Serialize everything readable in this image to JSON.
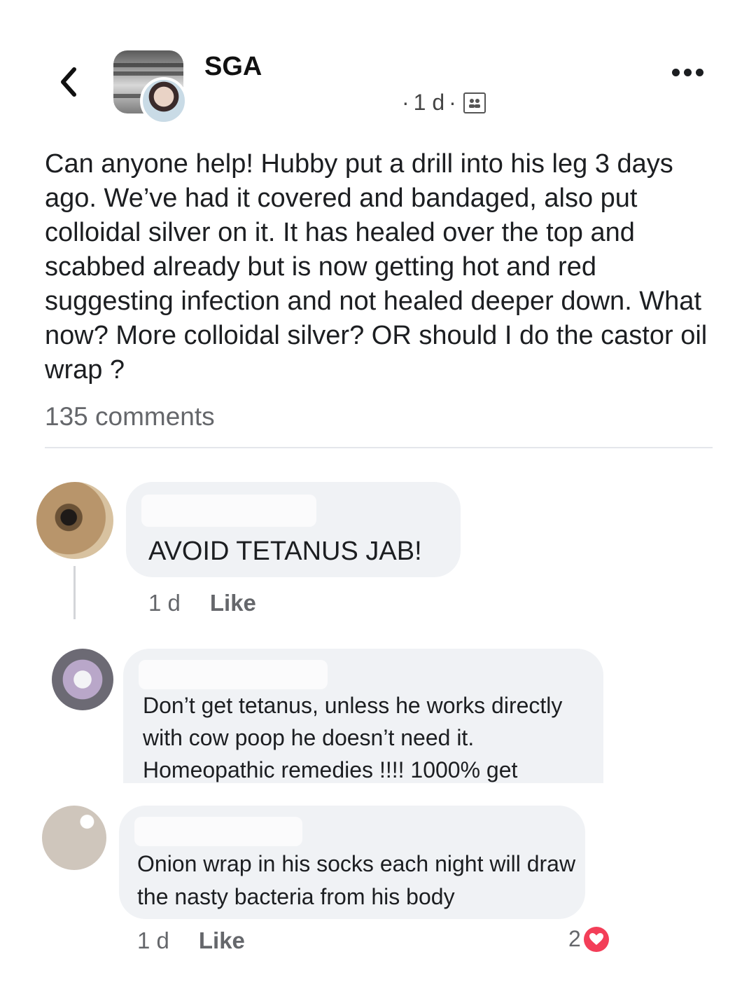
{
  "post": {
    "author": "SGA",
    "timestamp_prefix": "·",
    "timestamp": "1 d",
    "timestamp_suffix": "·",
    "text": "Can anyone help! Hubby put a drill into his leg 3 days ago. We’ve had it covered and bandaged, also put colloidal silver on it. It has healed over the top and scabbed already but is now getting hot and red suggesting infection and not healed deeper down. What now? More colloidal silver? OR should I do the castor oil wrap ?",
    "comments_count_label": "135 comments",
    "privacy_icon": "group-members-icon"
  },
  "comments": [
    {
      "text": "AVOID TETANUS JAB!",
      "time": "1 d",
      "like_label": "Like"
    },
    {
      "text": "Don’t get tetanus, unless he works directly with cow poop he doesn’t need it. Homeopathic remedies !!!! 1000% get"
    },
    {
      "text": "Onion wrap in his socks each night will draw the nasty bacteria from his body",
      "time": "1 d",
      "like_label": "Like",
      "reaction_count": "2",
      "reaction_icon": "heart-icon"
    }
  ],
  "colors": {
    "bubble": "#f0f2f5",
    "heart": "#f33e58",
    "secondary_text": "#65676b"
  }
}
